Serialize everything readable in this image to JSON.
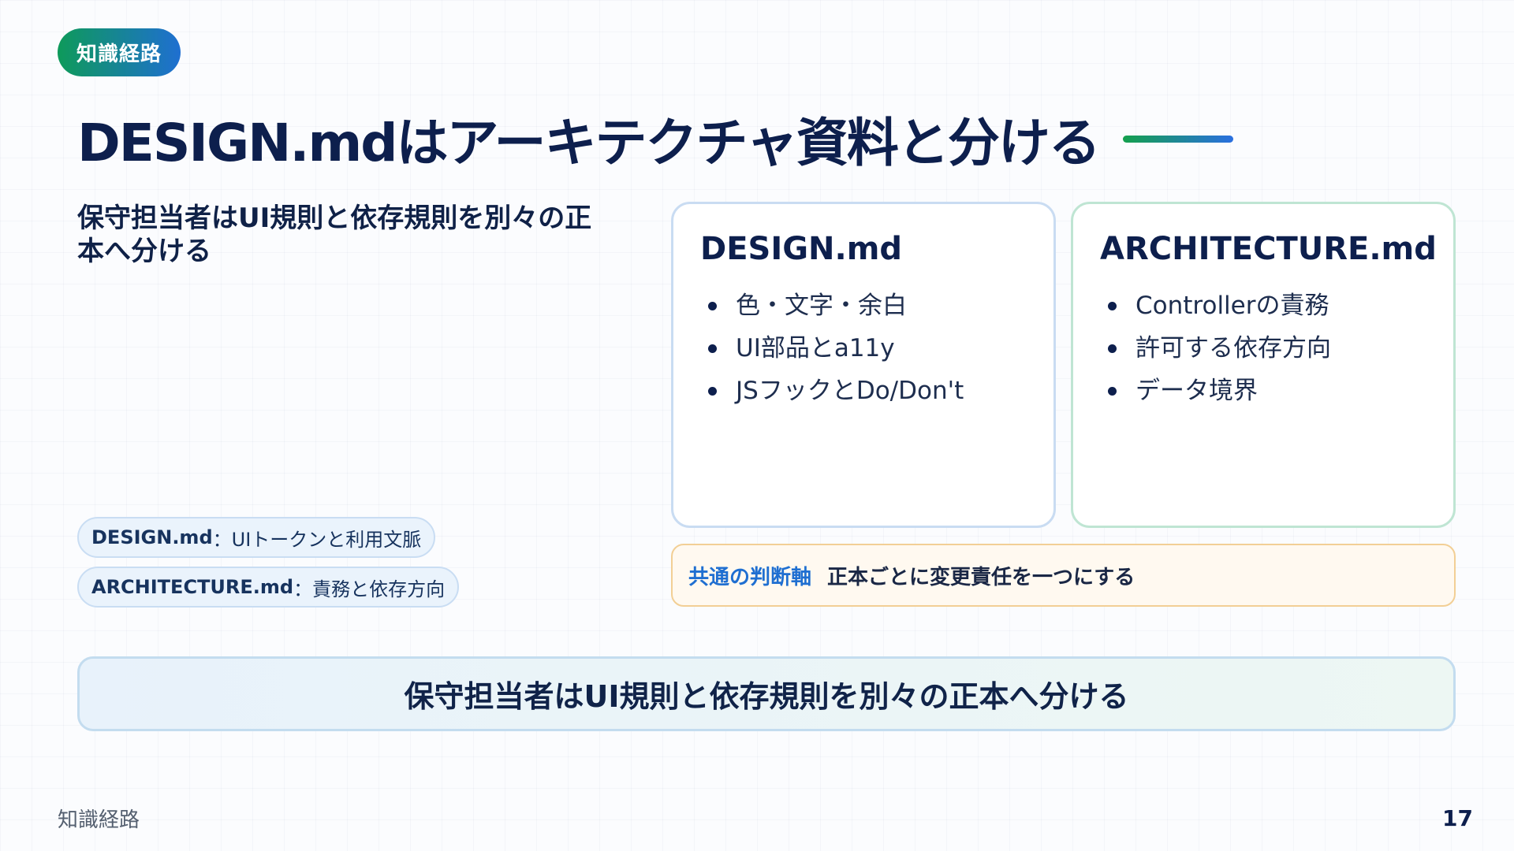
{
  "badge": "知識経路",
  "title": "DESIGN.mdはアーキテクチャ資料と分ける",
  "lead": "保守担当者はUI規則と依存規則を別々の正本へ分ける",
  "pills": [
    {
      "key": "DESIGN.md",
      "sep": "：",
      "text": "UIトークンと利用文脈"
    },
    {
      "key": "ARCHITECTURE.md",
      "sep": "：",
      "text": "責務と依存方向"
    }
  ],
  "cards": [
    {
      "title": "DESIGN.md",
      "items": [
        "色・文字・余白",
        "UI部品とa11y",
        "JSフックとDo/Don't"
      ]
    },
    {
      "title": "ARCHITECTURE.md",
      "items": [
        "Controllerの責務",
        "許可する依存方向",
        "データ境界"
      ]
    }
  ],
  "criteria": {
    "label": "共通の判断軸",
    "text": "正本ごとに変更責任を一つにする"
  },
  "banner": "保守担当者はUI規則と依存規則を別々の正本へ分ける",
  "footer": {
    "brand": "知識経路",
    "page": "17"
  },
  "colors": {
    "accent_green": "#0e9a5a",
    "accent_blue": "#1f6fd1",
    "navy": "#0d1f4d",
    "criteria_border": "#f2cf95"
  }
}
